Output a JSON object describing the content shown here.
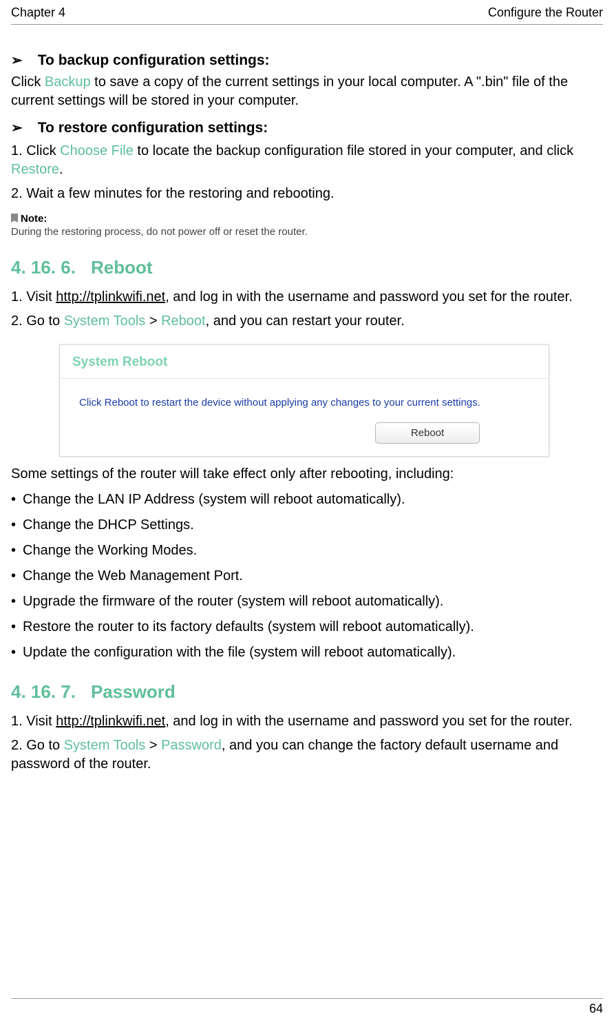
{
  "header": {
    "left": "Chapter 4",
    "right": "Configure the Router"
  },
  "backup": {
    "heading": "To backup configuration settings:",
    "para_pre": "Click ",
    "para_mid": "Backup",
    "para_post": " to save a copy of the current settings in your local computer. A \".bin\" file of the current settings will be stored in your computer."
  },
  "restore": {
    "heading": "To restore configuration settings:",
    "step1_pre": "1. Click ",
    "step1_choose": "Choose File",
    "step1_mid": " to locate the backup configuration file stored in your computer, and click ",
    "step1_restore": "Restore",
    "step1_end": ".",
    "step2": "2. Wait a few minutes for the restoring and rebooting.",
    "note_label": "Note:",
    "note_text": "During the restoring process, do not power off or reset the router."
  },
  "section_reboot": {
    "num": "4. 16. 6.",
    "title": "Reboot",
    "step1_pre": "1. Visit ",
    "step1_link": "http://tplinkwifi.net",
    "step1_post": ", and log in with the username and password you set for the router.",
    "step2_pre": "2. Go to ",
    "step2_a": "System Tools",
    "step2_sep": " > ",
    "step2_b": "Reboot",
    "step2_post": ", and you can restart your router.",
    "figure": {
      "title": "System Reboot",
      "desc": "Click Reboot to restart the device without applying any changes to your current settings.",
      "button": "Reboot"
    },
    "after_para": "Some settings of the router will take effect only after rebooting, including:",
    "bullets": [
      "Change the LAN IP Address (system will reboot automatically).",
      "Change the DHCP Settings.",
      "Change the Working Modes.",
      "Change the Web Management Port.",
      "Upgrade the firmware of the router (system will reboot automatically).",
      "Restore the router to its factory defaults (system will reboot automatically).",
      "Update the configuration with the file (system will reboot automatically)."
    ]
  },
  "section_password": {
    "num": "4. 16. 7.",
    "title": "Password",
    "step1_pre": "1. Visit ",
    "step1_link": "http://tplinkwifi.net",
    "step1_post": ", and log in with the username and password you set for the router.",
    "step2_pre": "2. Go to ",
    "step2_a": "System Tools",
    "step2_sep": " > ",
    "step2_b": "Password",
    "step2_post": ", and you can change the factory default username and password of the router."
  },
  "page_number": "64"
}
